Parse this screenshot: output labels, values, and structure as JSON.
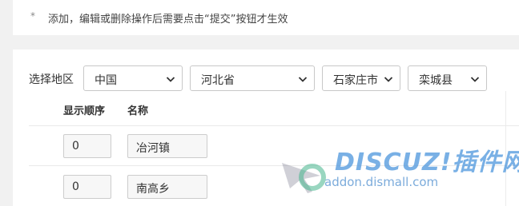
{
  "notice": {
    "bullet": "*",
    "text": "添加，编辑或删除操作后需要点击“提交”按钮才生效"
  },
  "region": {
    "label": "选择地区",
    "country": "中国",
    "province": "河北省",
    "city": "石家庄市",
    "county": "栾城县"
  },
  "table": {
    "columns": [
      "显示顺序",
      "名称"
    ],
    "rows": [
      {
        "order": "0",
        "name": "冶河镇"
      },
      {
        "order": "0",
        "name": "南高乡"
      }
    ]
  },
  "watermark": {
    "brand": "DISCUZ!插件网",
    "url": "addon.dismall.com"
  }
}
